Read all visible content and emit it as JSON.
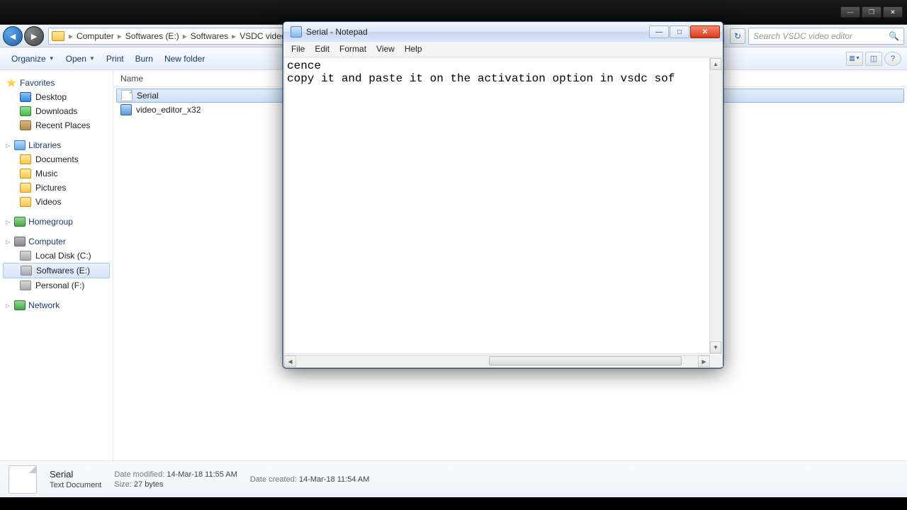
{
  "top_window": {
    "min": "—",
    "max": "❐",
    "close": "✕"
  },
  "explorer": {
    "breadcrumbs": [
      "Computer",
      "Softwares (E:)",
      "Softwares",
      "VSDC video"
    ],
    "search_placeholder": "Search VSDC video editor",
    "toolbar": {
      "organize": "Organize",
      "open": "Open",
      "print": "Print",
      "burn": "Burn",
      "new_folder": "New folder"
    },
    "sidebar": {
      "favorites": "Favorites",
      "fav_items": [
        "Desktop",
        "Downloads",
        "Recent Places"
      ],
      "libraries": "Libraries",
      "lib_items": [
        "Documents",
        "Music",
        "Pictures",
        "Videos"
      ],
      "homegroup": "Homegroup",
      "computer": "Computer",
      "drives": [
        "Local Disk (C:)",
        "Softwares (E:)",
        "Personal (F:)"
      ],
      "network": "Network"
    },
    "columns": {
      "name": "Name"
    },
    "files": [
      {
        "name": "Serial",
        "type": "txt"
      },
      {
        "name": "video_editor_x32",
        "type": "app"
      }
    ],
    "details": {
      "title": "Serial",
      "type": "Text Document",
      "modified_label": "Date modified:",
      "modified": "14-Mar-18 11:55 AM",
      "created_label": "Date created:",
      "created": "14-Mar-18 11:54 AM",
      "size_label": "Size:",
      "size": "27 bytes"
    }
  },
  "notepad": {
    "title": "Serial - Notepad",
    "menu": [
      "File",
      "Edit",
      "Format",
      "View",
      "Help"
    ],
    "text": "cence\ncopy it and paste it on the activation option in vsdc sof"
  }
}
